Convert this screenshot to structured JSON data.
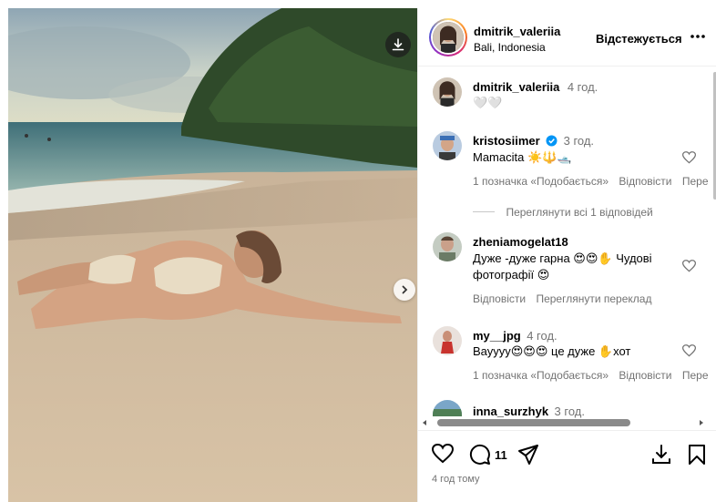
{
  "post": {
    "download_icon": "download-icon",
    "next_icon": "chevron-right-icon"
  },
  "header": {
    "username": "dmitrik_valeriia",
    "location": "Bali, Indonesia",
    "follow_label": "Відстежується",
    "more_icon": "more-options-icon"
  },
  "caption": {
    "username": "dmitrik_valeriia",
    "time": "4 год.",
    "text": "🤍🤍"
  },
  "comments": [
    {
      "username": "kristosiimer",
      "verified": true,
      "time": "3 год.",
      "text": "Mamacita ☀️🔱🛥️",
      "likes": "1 позначка «Подобається»",
      "reply": "Відповісти",
      "extra": "Пере",
      "view_replies": "Переглянути всі 1 відповідей"
    },
    {
      "username": "zheniamogelat18",
      "text_line1": "Дуже -дуже гарна 😍😍✋ Чудові",
      "text_line2": "фотографії 😍",
      "reply": "Відповісти",
      "translate": "Переглянути переклад"
    },
    {
      "username": "my__jpg",
      "time": "4 год.",
      "text": "Вауууу😍😍😍 це дуже ✋хот",
      "likes": "1 позначка «Подобається»",
      "reply": "Відповісти",
      "extra": "Пере"
    },
    {
      "username": "inna_surzhyk",
      "time": "3 год."
    }
  ],
  "actions": {
    "comment_count": "11",
    "posted_time": "4 год тому"
  },
  "colors": {
    "muted_text": "#737373",
    "verified_blue": "#0095f6",
    "border": "#efefef"
  }
}
